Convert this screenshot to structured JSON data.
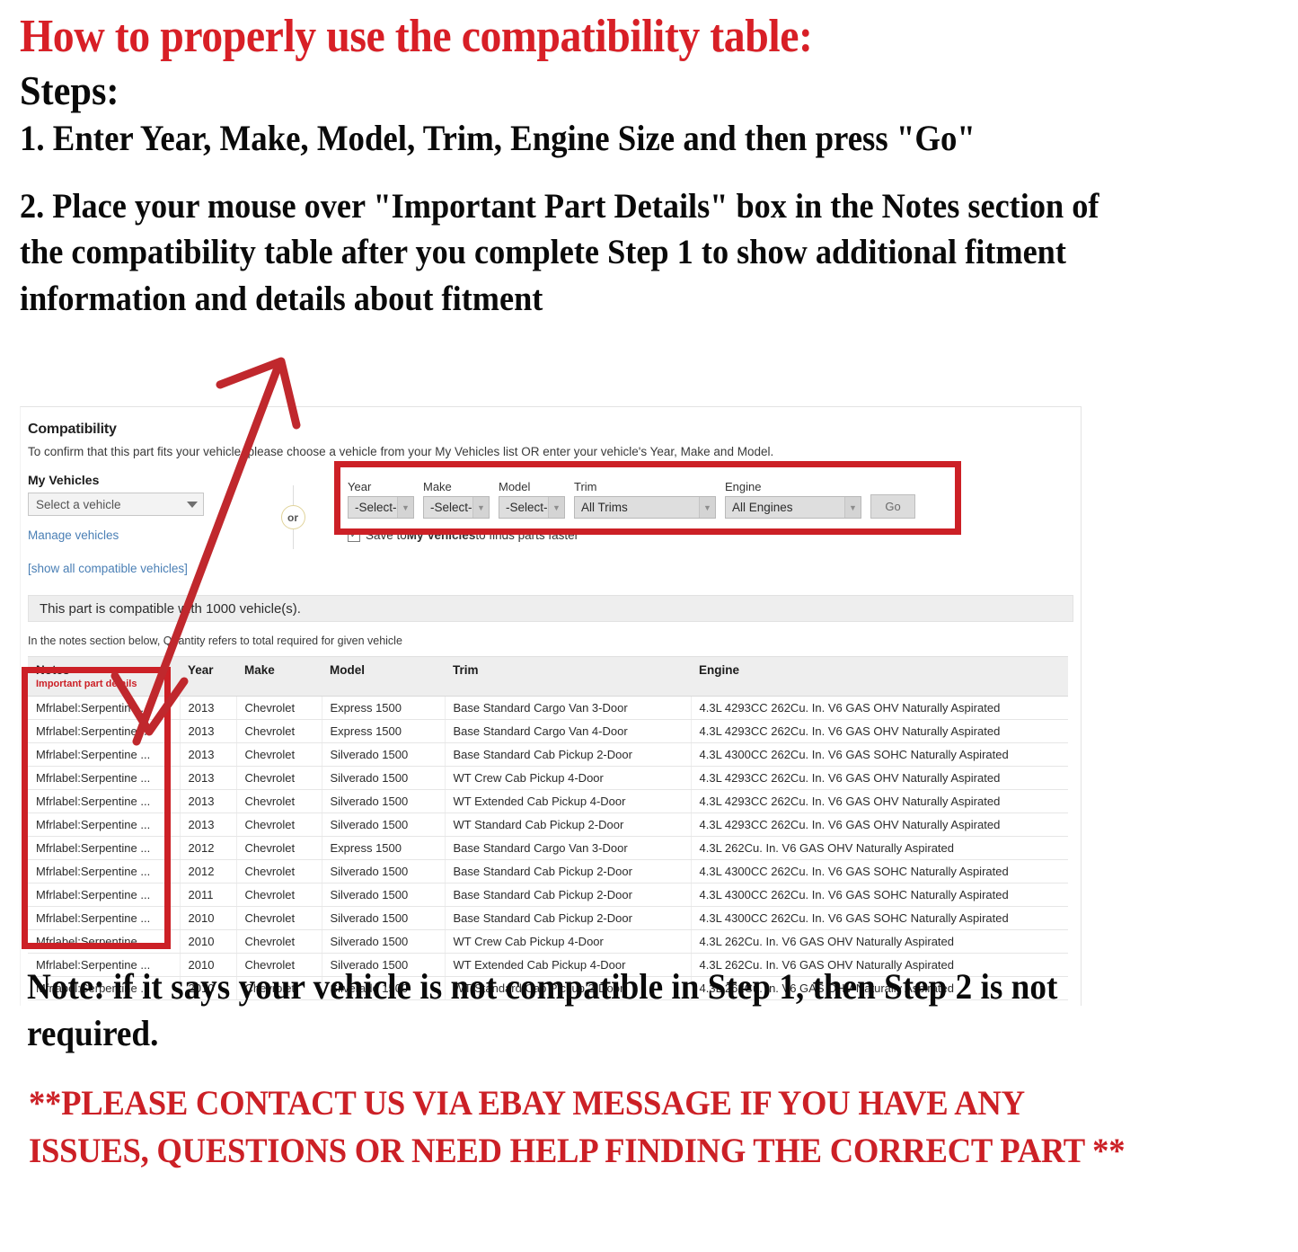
{
  "headline": {
    "title": "How to properly use the compatibility table:",
    "steps_label": "Steps:",
    "step1": "1. Enter Year, Make, Model, Trim, Engine Size and then press \"Go\"",
    "step2": "2. Place your mouse over \"Important Part Details\" box in the Notes section of the compatibility table after you complete Step 1 to show additional fitment information and details about fitment"
  },
  "colors": {
    "accent_red": "#cc2026",
    "title_red": "#d81f26",
    "link_blue": "#4a7fb5",
    "header_gray": "#eeeeee"
  },
  "compatibility": {
    "title": "Compatibility",
    "subtitle": "To confirm that this part fits your vehicle, please choose a vehicle from your My Vehicles list OR enter your vehicle's Year, Make and Model.",
    "my_vehicles": {
      "label": "My Vehicles",
      "select_value": "Select a vehicle",
      "manage_link": "Manage vehicles",
      "show_all_link": "[show all compatible vehicles]"
    },
    "or_badge": "or",
    "finder": {
      "year": {
        "label": "Year",
        "value": "-Select-"
      },
      "make": {
        "label": "Make",
        "value": "-Select-"
      },
      "model": {
        "label": "Model",
        "value": "-Select-"
      },
      "trim": {
        "label": "Trim",
        "value": "All Trims"
      },
      "engine": {
        "label": "Engine",
        "value": "All Engines"
      },
      "go_label": "Go",
      "save_checked": "✓",
      "save_text_pre": "Save to ",
      "save_text_bold": "My Vehicles",
      "save_text_post": " to finds parts faster"
    },
    "count_text": "This part is compatible with 1000 vehicle(s).",
    "notes_hint": "In the notes section below, Quantity refers to total required for given vehicle",
    "table": {
      "headers": {
        "notes": "Notes",
        "notes_sub": "Important part details",
        "year": "Year",
        "make": "Make",
        "model": "Model",
        "trim": "Trim",
        "engine": "Engine"
      },
      "rows": [
        {
          "notes": "Mfrlabel:Serpentine ...",
          "year": "2013",
          "make": "Chevrolet",
          "model": "Express 1500",
          "trim": "Base Standard Cargo Van 3-Door",
          "engine": "4.3L 4293CC 262Cu. In. V6 GAS OHV Naturally Aspirated"
        },
        {
          "notes": "Mfrlabel:Serpentine ...",
          "year": "2013",
          "make": "Chevrolet",
          "model": "Express 1500",
          "trim": "Base Standard Cargo Van 4-Door",
          "engine": "4.3L 4293CC 262Cu. In. V6 GAS OHV Naturally Aspirated"
        },
        {
          "notes": "Mfrlabel:Serpentine ...",
          "year": "2013",
          "make": "Chevrolet",
          "model": "Silverado 1500",
          "trim": "Base Standard Cab Pickup 2-Door",
          "engine": "4.3L 4300CC 262Cu. In. V6 GAS SOHC Naturally Aspirated"
        },
        {
          "notes": "Mfrlabel:Serpentine ...",
          "year": "2013",
          "make": "Chevrolet",
          "model": "Silverado 1500",
          "trim": "WT Crew Cab Pickup 4-Door",
          "engine": "4.3L 4293CC 262Cu. In. V6 GAS OHV Naturally Aspirated"
        },
        {
          "notes": "Mfrlabel:Serpentine ...",
          "year": "2013",
          "make": "Chevrolet",
          "model": "Silverado 1500",
          "trim": "WT Extended Cab Pickup 4-Door",
          "engine": "4.3L 4293CC 262Cu. In. V6 GAS OHV Naturally Aspirated"
        },
        {
          "notes": "Mfrlabel:Serpentine ...",
          "year": "2013",
          "make": "Chevrolet",
          "model": "Silverado 1500",
          "trim": "WT Standard Cab Pickup 2-Door",
          "engine": "4.3L 4293CC 262Cu. In. V6 GAS OHV Naturally Aspirated"
        },
        {
          "notes": "Mfrlabel:Serpentine ...",
          "year": "2012",
          "make": "Chevrolet",
          "model": "Express 1500",
          "trim": "Base Standard Cargo Van 3-Door",
          "engine": "4.3L 262Cu. In. V6 GAS OHV Naturally Aspirated"
        },
        {
          "notes": "Mfrlabel:Serpentine ...",
          "year": "2012",
          "make": "Chevrolet",
          "model": "Silverado 1500",
          "trim": "Base Standard Cab Pickup 2-Door",
          "engine": "4.3L 4300CC 262Cu. In. V6 GAS SOHC Naturally Aspirated"
        },
        {
          "notes": "Mfrlabel:Serpentine ...",
          "year": "2011",
          "make": "Chevrolet",
          "model": "Silverado 1500",
          "trim": "Base Standard Cab Pickup 2-Door",
          "engine": "4.3L 4300CC 262Cu. In. V6 GAS SOHC Naturally Aspirated"
        },
        {
          "notes": "Mfrlabel:Serpentine ...",
          "year": "2010",
          "make": "Chevrolet",
          "model": "Silverado 1500",
          "trim": "Base Standard Cab Pickup 2-Door",
          "engine": "4.3L 4300CC 262Cu. In. V6 GAS SOHC Naturally Aspirated"
        },
        {
          "notes": "Mfrlabel:Serpentine ...",
          "year": "2010",
          "make": "Chevrolet",
          "model": "Silverado 1500",
          "trim": "WT Crew Cab Pickup 4-Door",
          "engine": "4.3L 262Cu. In. V6 GAS OHV Naturally Aspirated"
        },
        {
          "notes": "Mfrlabel:Serpentine ...",
          "year": "2010",
          "make": "Chevrolet",
          "model": "Silverado 1500",
          "trim": "WT Extended Cab Pickup 4-Door",
          "engine": "4.3L 262Cu. In. V6 GAS OHV Naturally Aspirated"
        },
        {
          "notes": "Mfrlabel:Serpentine ...",
          "year": "2010",
          "make": "Chevrolet",
          "model": "Silverado 1500",
          "trim": "WT Standard Cab Pickup 2-Door",
          "engine": "4.3L 262Cu. In. V6 GAS OHV Naturally Aspirated"
        }
      ]
    }
  },
  "footer": {
    "note": "Note: if it says your vehicle is not compatible in Step 1, then Step 2 is not required.",
    "contact": "**PLEASE CONTACT US VIA EBAY MESSAGE IF YOU HAVE ANY ISSUES, QUESTIONS OR NEED HELP FINDING THE CORRECT PART **"
  }
}
